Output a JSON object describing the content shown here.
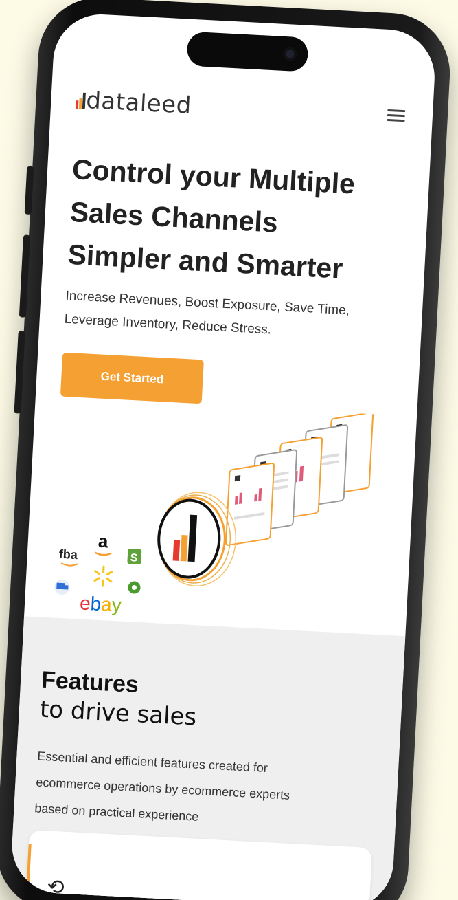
{
  "brand": {
    "logo_text": "dataleed",
    "accent_color": "#f5a033"
  },
  "header": {
    "menu_icon": "hamburger-menu-icon"
  },
  "hero": {
    "title_line1": "Control your Multiple",
    "title_line2": "Sales Channels",
    "title_line3": "Simpler and Smarter",
    "subtitle_line1": "Increase Revenues, Boost Exposure, Save Time,",
    "subtitle_line2": "Leverage Inventory, Reduce Stress.",
    "cta_label": "Get Started"
  },
  "illustration": {
    "channel_logos": [
      "fba",
      "a",
      "S",
      "ebay"
    ],
    "channel_icons": [
      "delivery-truck-icon",
      "walmart-spark-icon",
      "gear-icon",
      "shopify-bag-icon",
      "amazon-smile-icon"
    ],
    "center_logo": "dataleed-d-logo-icon"
  },
  "features": {
    "title": "Features",
    "subtitle": "to drive sales",
    "description_line1": "Essential and efficient features created for",
    "description_line2": "ecommerce operations by ecommerce experts",
    "description_line3": "based on practical experience",
    "card_icon": "refresh-icon"
  }
}
